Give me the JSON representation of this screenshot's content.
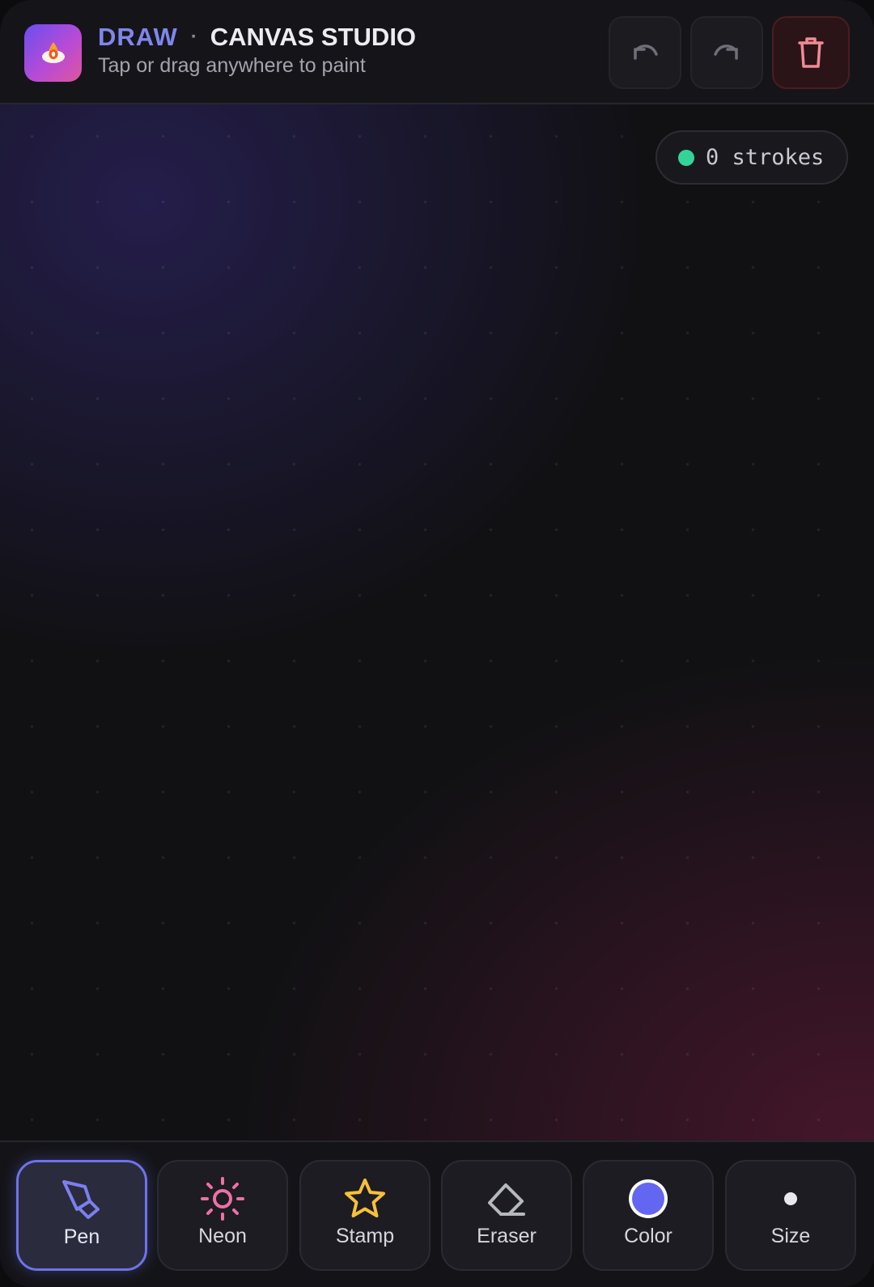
{
  "header": {
    "brand": "DRAW",
    "separator": "·",
    "app_name": "CANVAS STUDIO",
    "subtitle": "Tap or drag anywhere to paint",
    "buttons": {
      "undo": "undo-icon",
      "redo": "redo-icon",
      "clear": "trash-icon"
    }
  },
  "canvas": {
    "stroke_count_text": "0 strokes",
    "status_color": "#34d399"
  },
  "toolbar": {
    "tools": [
      {
        "label": "Pen",
        "icon": "pen-icon",
        "active": true,
        "color": "#7c7ff0"
      },
      {
        "label": "Neon",
        "icon": "sun-icon",
        "active": false,
        "color": "#f06fa6"
      },
      {
        "label": "Stamp",
        "icon": "star-icon",
        "active": false,
        "color": "#f7c03a"
      },
      {
        "label": "Eraser",
        "icon": "eraser-icon",
        "active": false,
        "color": "#b7b7c0"
      },
      {
        "label": "Color",
        "icon": "color-swatch-icon",
        "active": false,
        "color": "#6366f1"
      },
      {
        "label": "Size",
        "icon": "brush-size-icon",
        "active": false,
        "color": "#e8e8ee"
      }
    ]
  },
  "theme": {
    "accent": "#6e72ea",
    "danger": "#f18a95"
  }
}
